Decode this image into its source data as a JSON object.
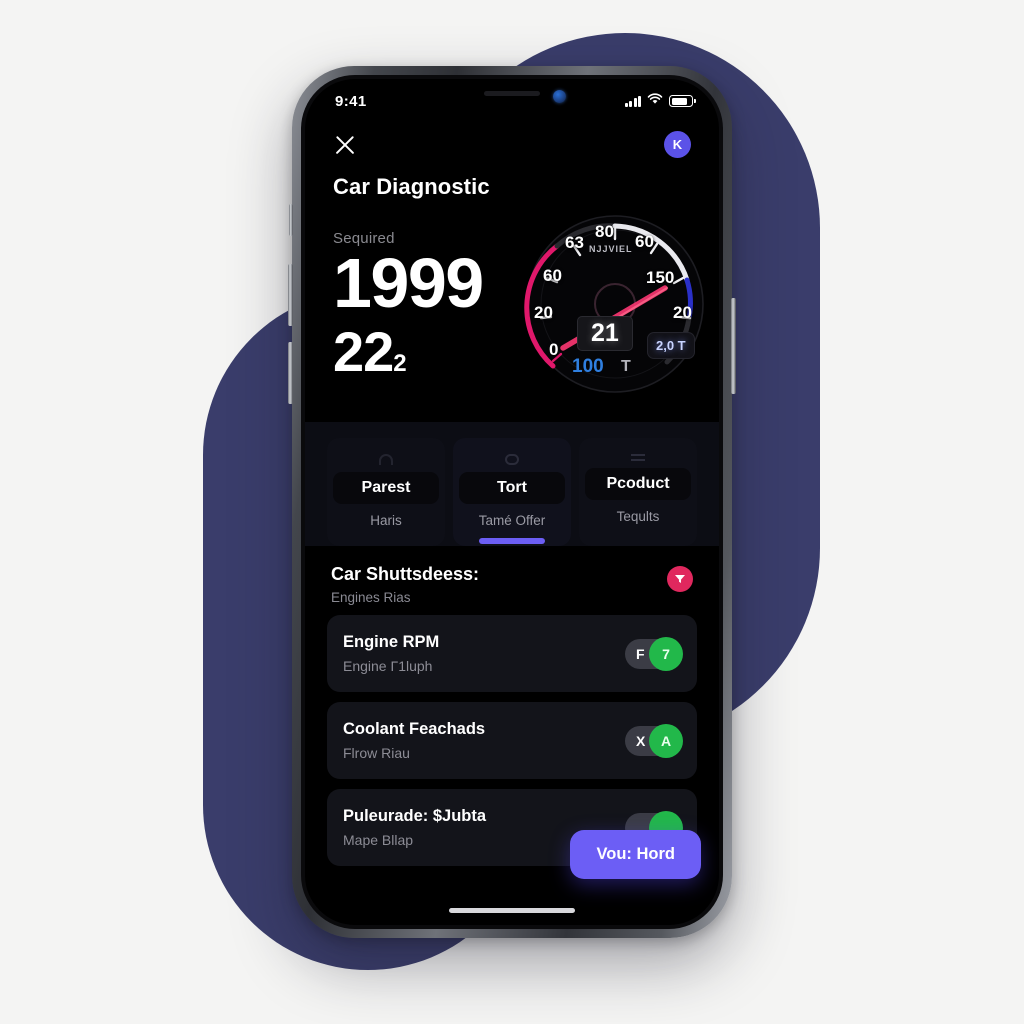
{
  "status_bar": {
    "time": "9:41",
    "signal_icon": "cellular-bars-icon",
    "wifi_icon": "wifi-icon",
    "battery_icon": "battery-icon"
  },
  "header": {
    "close_icon": "close-icon",
    "title": "Car Diagnostic",
    "badge_label": "K"
  },
  "metric": {
    "label": "Sequired",
    "value": "1999",
    "secondary": "22",
    "secondary_sub": "2"
  },
  "chart_data": {
    "type": "gauge",
    "title": "NJJVIEL",
    "needle_value": 21,
    "digital_readout": "21",
    "secondary_readout": "100",
    "unit_marker": "T",
    "chip_readout": "2,0 T",
    "tick_labels": [
      "0",
      "20",
      "60",
      "63",
      "80",
      "60",
      "150",
      "20"
    ],
    "arc_segments": [
      {
        "name": "low",
        "color": "#e0186b"
      },
      {
        "name": "mid",
        "color": "#e9e9ee"
      },
      {
        "name": "high",
        "color": "#2a30c8"
      }
    ],
    "needle_color": "#f0356e",
    "ylim": [
      0,
      180
    ]
  },
  "tabs": [
    {
      "icon": "lock-icon",
      "label": "Parest",
      "sub": "Haris",
      "active": false
    },
    {
      "icon": "shield-icon",
      "label": "Tort",
      "sub": "Tamé Offer",
      "active": true
    },
    {
      "icon": "list-icon",
      "label": "Pcoduct",
      "sub": "Teqults",
      "active": false
    }
  ],
  "section": {
    "title": "Car Shuttsdeess:",
    "subtitle": "Engines Rias",
    "filter_icon": "filter-funnel-icon"
  },
  "list": [
    {
      "title": "Engine RPM",
      "sub": "Engine Γ1luph",
      "toggle_off_label": "F",
      "toggle_knob_label": "7",
      "state": "on"
    },
    {
      "title": "Coolant Feachads",
      "sub": "Flrow Riau",
      "toggle_off_label": "X",
      "toggle_knob_label": "A",
      "state": "on"
    },
    {
      "title": "Puleurade: $Jubta",
      "sub": "Mape Bllap",
      "toggle_off_label": "",
      "toggle_knob_label": "",
      "state": "on"
    }
  ],
  "cta": {
    "label": "Vou: Hord"
  },
  "colors": {
    "accent_purple": "#6c5ef5",
    "accent_pink": "#e0285e",
    "toggle_green": "#22b84a",
    "blob_navy": "#3a3d6b",
    "readout_blue": "#2f7fe0"
  }
}
